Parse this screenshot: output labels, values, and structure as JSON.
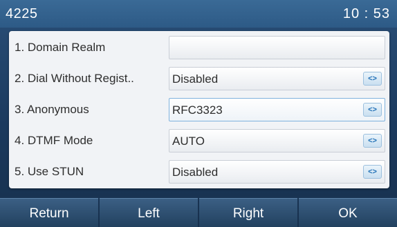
{
  "status_bar": {
    "account": "4225",
    "time": "10 : 53"
  },
  "settings": [
    {
      "label": "1. Domain Realm",
      "value": "",
      "has_selector": false
    },
    {
      "label": "2. Dial Without Regist..",
      "value": "Disabled",
      "has_selector": true
    },
    {
      "label": "3. Anonymous",
      "value": "RFC3323",
      "has_selector": true,
      "selected": true
    },
    {
      "label": "4. DTMF Mode",
      "value": "AUTO",
      "has_selector": true
    },
    {
      "label": "5. Use STUN",
      "value": "Disabled",
      "has_selector": true
    }
  ],
  "selector_icon": "left-right-arrows-icon",
  "softkeys": {
    "return": "Return",
    "left": "Left",
    "right": "Right",
    "ok": "OK"
  },
  "colors": {
    "title_bar": "#2d5a86",
    "panel": "#f1f3f6",
    "accent": "#1f6fb5",
    "softkey": "#22415f"
  }
}
